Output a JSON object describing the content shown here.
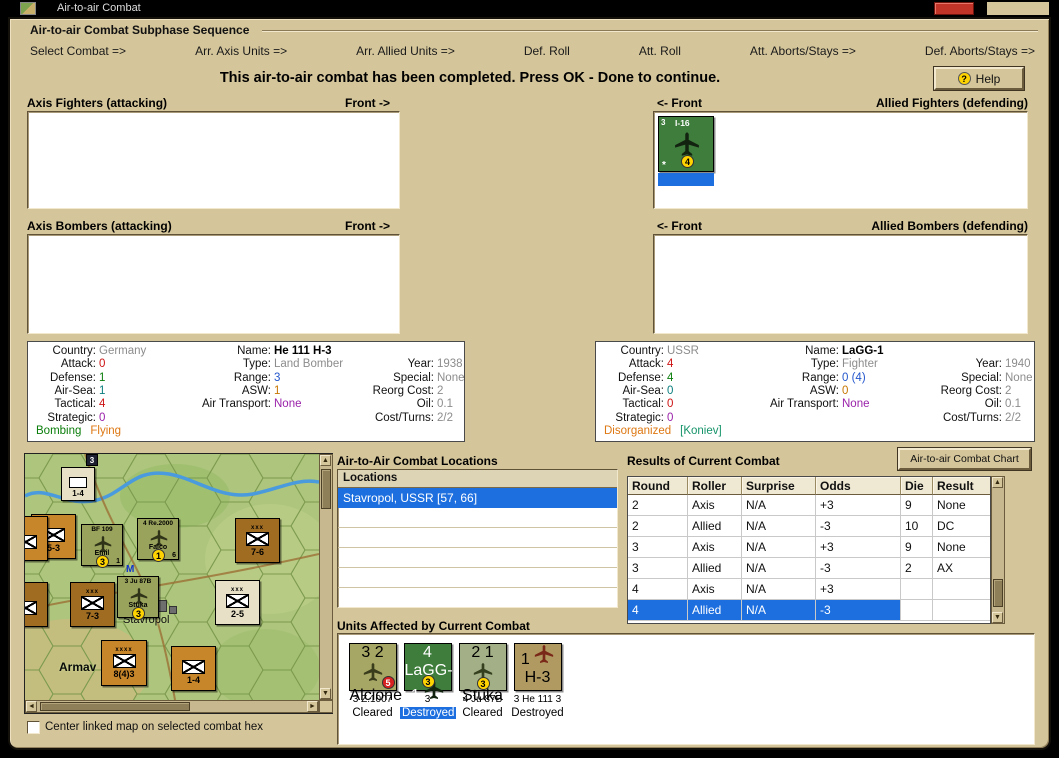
{
  "colors": {
    "selection_blue": "#1d6fe0",
    "dialog_tan": "#d4c59a",
    "titlebar_black": "#000000",
    "titlebar_red": "#c23428",
    "map_green": "#adc57c",
    "axis_counter_orange": "#c8862a",
    "axis_counter_brown": "#a06c22",
    "axis_air_olive": "#9aa35c",
    "soviet_counter_green": "#3e7d3c",
    "badge_yellow": "#ffd300",
    "badge_red": "#d82020"
  },
  "titlebar": {
    "title": "Air-to-air Combat"
  },
  "sequence": {
    "title": "Air-to-air Combat Subphase Sequence",
    "steps": [
      "Select Combat =>",
      "Arr. Axis Units =>",
      "Arr. Allied Units =>",
      "Def. Roll",
      "Att. Roll",
      "Att. Aborts/Stays =>",
      "Def. Aborts/Stays =>"
    ]
  },
  "banner": {
    "message": "This air-to-air combat has been completed.  Press OK - Done to continue.",
    "help_label": "Help"
  },
  "sections": {
    "axis_fighters": "Axis Fighters (attacking)",
    "allied_fighters": "Allied Fighters (defending)",
    "axis_bombers": "Axis Bombers (attacking)",
    "allied_bombers": "Allied Bombers (defending)",
    "front_attacker": "Front ->",
    "front_defender": "<- Front"
  },
  "allied_fighter_unit": {
    "strength": "3",
    "name": "I-16",
    "asterisk": "*",
    "badge": "4"
  },
  "unit_info_left": {
    "country_label": "Country:",
    "country": "Germany",
    "name_label": "Name:",
    "name": "He 111 H-3",
    "attack_label": "Attack:",
    "attack": "0",
    "type_label": "Type:",
    "type": "Land Bomber",
    "year_label": "Year:",
    "year": "1938",
    "defense_label": "Defense:",
    "defense": "1",
    "range_label": "Range:",
    "range": "3",
    "special_label": "Special:",
    "special": "None",
    "air_sea_label": "Air-Sea:",
    "air_sea": "1",
    "asw_label": "ASW:",
    "asw": "1",
    "reorg_label": "Reorg Cost:",
    "reorg": "2",
    "tactical_label": "Tactical:",
    "tactical": "4",
    "air_transport_label": "Air Transport:",
    "air_transport": "None",
    "oil_label": "Oil:",
    "oil": "0.1",
    "strategic_label": "Strategic:",
    "strategic": "0",
    "cost_turns_label": "Cost/Turns:",
    "cost_turns": "2/2",
    "status_1": "Bombing",
    "status_2": "Flying"
  },
  "unit_info_right": {
    "country_label": "Country:",
    "country": "USSR",
    "name_label": "Name:",
    "name": "LaGG-1",
    "attack_label": "Attack:",
    "attack": "4",
    "type_label": "Type:",
    "type": "Fighter",
    "year_label": "Year:",
    "year": "1940",
    "defense_label": "Defense:",
    "defense": "4",
    "range_label": "Range:",
    "range": "0 (4)",
    "special_label": "Special:",
    "special": "None",
    "air_sea_label": "Air-Sea:",
    "air_sea": "0",
    "asw_label": "ASW:",
    "asw": "0",
    "reorg_label": "Reorg Cost:",
    "reorg": "2",
    "tactical_label": "Tactical:",
    "tactical": "0",
    "air_transport_label": "Air Transport:",
    "air_transport": "None",
    "oil_label": "Oil:",
    "oil": "0.1",
    "strategic_label": "Strategic:",
    "strategic": "0",
    "cost_turns_label": "Cost/Turns:",
    "cost_turns": "2/2",
    "status_1": "Disorganized",
    "status_2": "[Koniev]"
  },
  "map_panel": {
    "city_label": "Stavropol",
    "city_label_2": "Armav",
    "hex_chip": "3",
    "mission_marker": "M",
    "ground_counters": [
      {
        "strength": "1-4",
        "echelon": ""
      },
      {
        "strength": "5-3",
        "echelon": ""
      },
      {
        "strength": "7-6",
        "echelon": "xxx"
      },
      {
        "strength": "7-3",
        "echelon": "xxx"
      },
      {
        "strength": "2-5",
        "echelon": "xxx"
      },
      {
        "strength": "8(4)3",
        "echelon": "xxxx"
      },
      {
        "strength": "1-4",
        "echelon": ""
      }
    ],
    "air_counters": [
      {
        "top": "BF 109",
        "name": "Emil",
        "corner": "1",
        "badge": "3"
      },
      {
        "top": "4 Re.2000",
        "name": "Falco",
        "corner": "6",
        "badge": "1"
      },
      {
        "top": "3 Ju 87B",
        "name": "Stuka",
        "corner": "",
        "badge": "3"
      }
    ],
    "checkbox_label": "Center linked map on selected combat hex"
  },
  "locations": {
    "title": "Air-to-Air Combat Locations",
    "header": "Locations",
    "selected_item": "Stavropol, USSR [57, 66]"
  },
  "results": {
    "title": "Results of Current Combat",
    "chart_button_label": "Air-to-air Combat Chart",
    "columns": [
      "Round",
      "Roller",
      "Surprise",
      "Odds",
      "Die",
      "Result"
    ],
    "rows": [
      [
        "2",
        "Axis",
        "N/A",
        "+3",
        "9",
        "None"
      ],
      [
        "2",
        "Allied",
        "N/A",
        "-3",
        "10",
        "DC"
      ],
      [
        "3",
        "Axis",
        "N/A",
        "+3",
        "9",
        "None"
      ],
      [
        "3",
        "Allied",
        "N/A",
        "-3",
        "2",
        "AX"
      ],
      [
        "4",
        "Axis",
        "N/A",
        "+3",
        "",
        ""
      ],
      [
        "4",
        "Allied",
        "N/A",
        "-3",
        "",
        ""
      ]
    ],
    "selected_row_index": 5
  },
  "units_affected": {
    "title": "Units Affected by Current Combat",
    "units": [
      {
        "top_left": "3",
        "top_right": "2",
        "name": "Alcione",
        "badge": "5",
        "caption": "3 Z.1007",
        "status": "Cleared"
      },
      {
        "top_left": "4",
        "top_right": "",
        "name": "LaGG-1",
        "badge": "3",
        "caption": "3",
        "status": "Destroyed"
      },
      {
        "top_left": "2",
        "top_right": "1",
        "name": "Stuka",
        "badge": "3",
        "caption": "4 Ju 87B",
        "status": "Cleared"
      },
      {
        "top_left": "",
        "top_right": "1",
        "name": "H-3",
        "badge": "",
        "caption": "3 He 111 3",
        "status": "Destroyed"
      }
    ]
  }
}
